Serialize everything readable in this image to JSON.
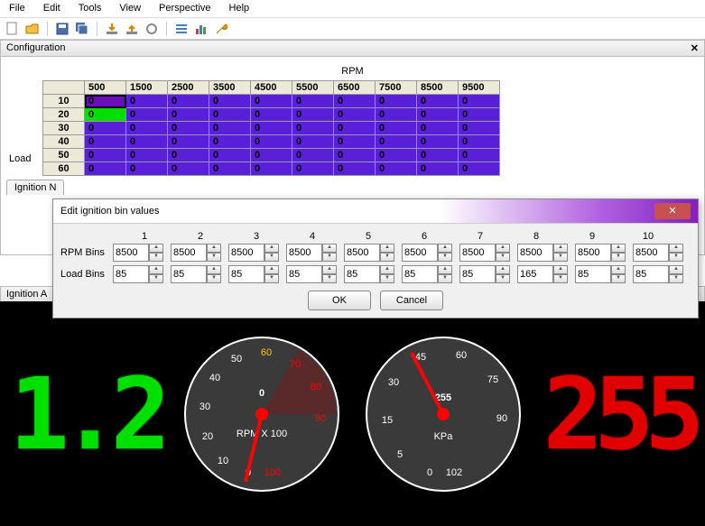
{
  "menu": {
    "file": "File",
    "edit": "Edit",
    "tools": "Tools",
    "view": "View",
    "perspective": "Perspective",
    "help": "Help"
  },
  "config": {
    "title": "Configuration",
    "rpm_label": "RPM",
    "load_label": "Load",
    "col_headers": [
      "500",
      "1500",
      "2500",
      "3500",
      "4500",
      "5500",
      "6500",
      "7500",
      "8500",
      "9500"
    ],
    "row_headers": [
      "10",
      "20",
      "30",
      "40",
      "50",
      "60"
    ],
    "rows": [
      [
        "0",
        "0",
        "0",
        "0",
        "0",
        "0",
        "0",
        "0",
        "0",
        "0"
      ],
      [
        "0",
        "0",
        "0",
        "0",
        "0",
        "0",
        "0",
        "0",
        "0",
        "0"
      ],
      [
        "0",
        "0",
        "0",
        "0",
        "0",
        "0",
        "0",
        "0",
        "0",
        "0"
      ],
      [
        "0",
        "0",
        "0",
        "0",
        "0",
        "0",
        "0",
        "0",
        "0",
        "0"
      ],
      [
        "0",
        "0",
        "0",
        "0",
        "0",
        "0",
        "0",
        "0",
        "0",
        "0"
      ],
      [
        "0",
        "0",
        "0",
        "0",
        "0",
        "0",
        "0",
        "0",
        "0",
        "0"
      ]
    ]
  },
  "tabs": {
    "ign_n": "Ignition N",
    "ign_a": "Ignition A"
  },
  "dialog": {
    "title": "Edit ignition bin values",
    "col_nums": [
      "1",
      "2",
      "3",
      "4",
      "5",
      "6",
      "7",
      "8",
      "9",
      "10"
    ],
    "rpm_label": "RPM Bins",
    "load_label": "Load Bins",
    "rpm_vals": [
      "8500",
      "8500",
      "8500",
      "8500",
      "8500",
      "8500",
      "8500",
      "8500",
      "8500",
      "8500"
    ],
    "load_vals": [
      "85",
      "85",
      "85",
      "85",
      "85",
      "85",
      "85",
      "165",
      "85",
      "85"
    ],
    "ok": "OK",
    "cancel": "Cancel"
  },
  "gauges": {
    "left_value": "1.2",
    "right_value": "255",
    "rpm": {
      "label": "RPM X 100",
      "value": "0",
      "ticks": [
        "0",
        "10",
        "20",
        "30",
        "40",
        "50",
        "60",
        "70",
        "80",
        "90",
        "100"
      ]
    },
    "kpa": {
      "label": "KPa",
      "value": "255",
      "ticks": [
        "0",
        "5",
        "15",
        "30",
        "45",
        "60",
        "75",
        "90",
        "102"
      ]
    }
  }
}
